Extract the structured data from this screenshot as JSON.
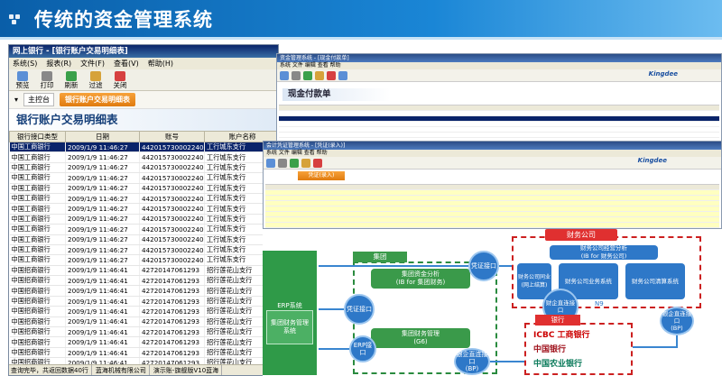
{
  "banner": {
    "title": "传统的资金管理系统"
  },
  "left_window": {
    "title": "网上银行 - [银行账户交易明细表]",
    "menu": [
      "系统(S)",
      "报表(R)",
      "文件(F)",
      "查看(V)",
      "帮助(H)"
    ],
    "toolbar": [
      "预览",
      "打印",
      "刷新",
      "过滤",
      "关闭"
    ],
    "nav_home": "主控台",
    "nav_tab": "银行账户交易明细表",
    "page_title": "银行账户交易明细表",
    "columns": [
      "银行接口类型",
      "日期",
      "账号",
      "账户名称"
    ],
    "rows": [
      [
        "中国工商银行",
        "2009/1/9 11:46:27",
        "4420157300022​40",
        "工行城东支行"
      ],
      [
        "中国工商银行",
        "2009/1/9 11:46:27",
        "442015730002240",
        "工行城东支行"
      ],
      [
        "中国工商银行",
        "2009/1/9 11:46:27",
        "442015730002240",
        "工行城东支行"
      ],
      [
        "中国工商银行",
        "2009/1/9 11:46:27",
        "442015730002240",
        "工行城东支行"
      ],
      [
        "中国工商银行",
        "2009/1/9 11:46:27",
        "442015730002240",
        "工行城东支行"
      ],
      [
        "中国工商银行",
        "2009/1/9 11:46:27",
        "442015730002240",
        "工行城东支行"
      ],
      [
        "中国工商银行",
        "2009/1/9 11:46:27",
        "442015730002240",
        "工行城东支行"
      ],
      [
        "中国工商银行",
        "2009/1/9 11:46:27",
        "442015730002240",
        "工行城东支行"
      ],
      [
        "中国工商银行",
        "2009/1/9 11:46:27",
        "442015730002240",
        "工行城东支行"
      ],
      [
        "中国工商银行",
        "2009/1/9 11:46:27",
        "442015730002240",
        "工行城东支行"
      ],
      [
        "中国工商银行",
        "2009/1/9 11:46:27",
        "442015730002240",
        "工行城东支行"
      ],
      [
        "中国工商银行",
        "2009/1/9 11:46:27",
        "442015730002240",
        "工行城东支行"
      ],
      [
        "中国招商银行",
        "2009/1/9 11:46:41",
        "427201470612​93",
        "招行莲花山支行"
      ],
      [
        "中国招商银行",
        "2009/1/9 11:46:41",
        "42720147061293",
        "招行莲花山支行"
      ],
      [
        "中国招商银行",
        "2009/1/9 11:46:41",
        "42720147061293",
        "招行莲花山支行"
      ],
      [
        "中国招商银行",
        "2009/1/9 11:46:41",
        "42720147061293",
        "招行莲花山支行"
      ],
      [
        "中国招商银行",
        "2009/1/9 11:46:41",
        "42720147061293",
        "招行莲花山支行"
      ],
      [
        "中国招商银行",
        "2009/1/9 11:46:41",
        "42720147061293",
        "招行莲花山支行"
      ],
      [
        "中国招商银行",
        "2009/1/9 11:46:41",
        "42720147061293",
        "招行莲花山支行"
      ],
      [
        "中国招商银行",
        "2009/1/9 11:46:41",
        "42720147061293",
        "招行莲花山支行"
      ],
      [
        "中国招商银行",
        "2009/1/9 11:46:41",
        "42720147061293",
        "招行莲花山支行"
      ],
      [
        "中国招商银行",
        "2009/1/9 11:46:41",
        "42720147061293",
        "招行莲花山支行"
      ],
      [
        "中国招商银行",
        "2009/1/9 11:46:41",
        "42720147061293",
        "招行莲花山支行"
      ],
      [
        "中国招商银行",
        "2009/1/9 11:46:41",
        "42720147061293",
        "招行莲花山支行"
      ]
    ],
    "status": [
      "查询完毕，共返回数据40行",
      "蓝海机械有限公司",
      "演示账-旗舰版V10蓝海"
    ]
  },
  "right_top_window": {
    "title": "资金管理系统 - [现金付款单]",
    "brand": "Kingdee",
    "form_title": "现金付款单"
  },
  "right_mid_window": {
    "title": "会计凭证管理系统 - [凭证(录入)]",
    "brand": "Kingdee",
    "tab": "凭证(录入)"
  },
  "diagram": {
    "erp_system": "ERP系统",
    "erp_box": "集团财务管理系统",
    "group_label": "集团",
    "group_analysis": "集团资金分析\n(IB for 集团财务)",
    "group_mgmt": "集团财务管理\n(G6)",
    "interface_voucher": "凭证接口",
    "interface_erp": "ERP接口",
    "interface_bank": "银企直连接口\n(BP)",
    "interface_voucher2": "凭证接口",
    "fin_company_label": "财务公司",
    "fin_analysis": "财务公司经营分析\n(IB for 财务公司)",
    "fin_box1": "财务公司同业(网上结算)",
    "fin_box2": "财务公司业务系统",
    "fin_box3": "财务公司清算系统",
    "fin_gateway": "财企直连接口",
    "fin_n9": "N9",
    "fin_bank_iface": "银企直连接口\n(BP)",
    "bank_label": "银行",
    "bank_logos": [
      "ICBC 工商银行",
      "中国银行",
      "中国农业银行"
    ],
    "colors": {
      "green": "#2f9a48",
      "blue": "#2e78c8",
      "red": "#e03030"
    }
  }
}
